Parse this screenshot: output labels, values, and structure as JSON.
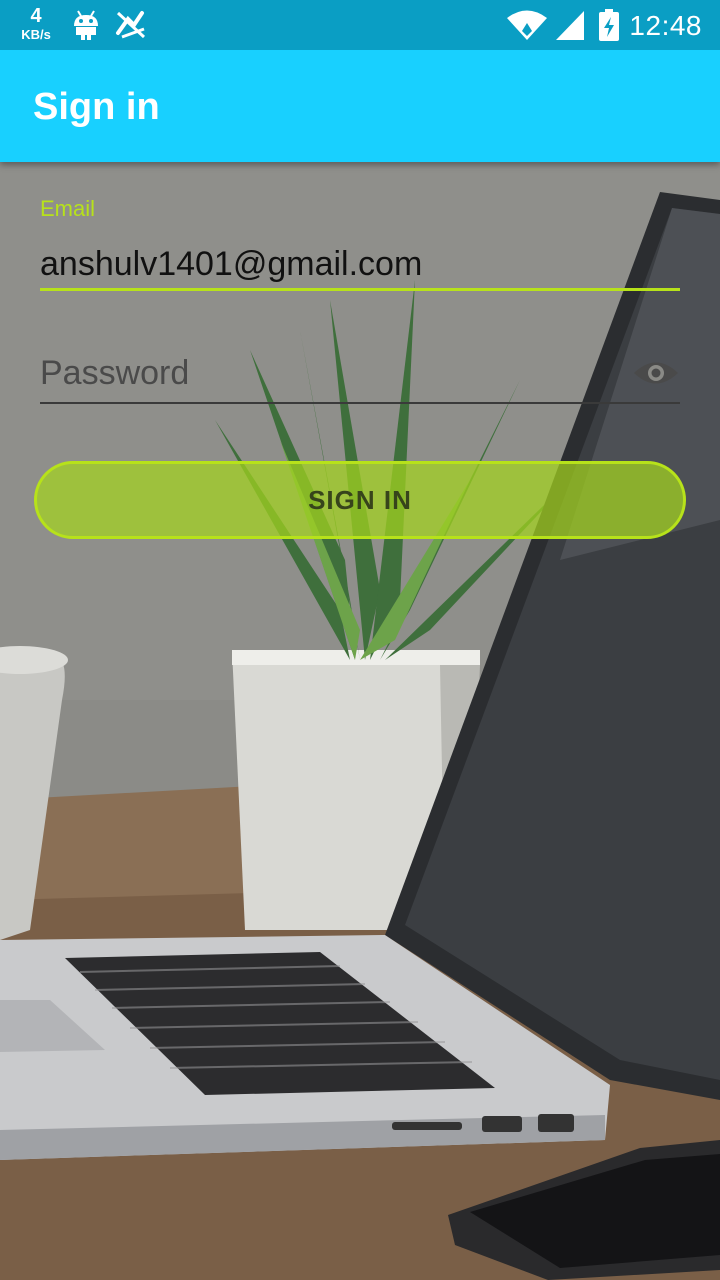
{
  "status_bar": {
    "net_speed_value": "4",
    "net_speed_unit": "KB/s",
    "time": "12:48",
    "icons": [
      "notification-android-icon",
      "notification-muted-icon",
      "wifi-icon",
      "cell-signal-icon",
      "battery-charging-icon"
    ]
  },
  "app_bar": {
    "title": "Sign in"
  },
  "form": {
    "email_label": "Email",
    "email_value": "anshulv1401@gmail.com",
    "password_placeholder": "Password",
    "password_visibility_icon": "eye-icon",
    "signin_label": "SIGN IN"
  },
  "colors": {
    "status_bar": "#0a9ec4",
    "app_bar": "#18d0ff",
    "accent": "#b7e21a",
    "button_fill": "#a4d41e"
  }
}
